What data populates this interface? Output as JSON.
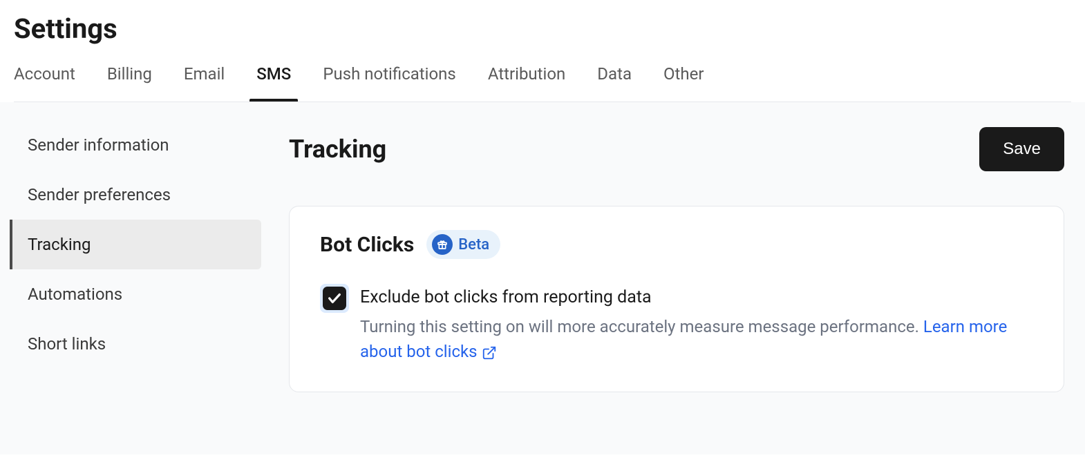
{
  "page_title": "Settings",
  "tabs": [
    {
      "label": "Account",
      "active": false
    },
    {
      "label": "Billing",
      "active": false
    },
    {
      "label": "Email",
      "active": false
    },
    {
      "label": "SMS",
      "active": true
    },
    {
      "label": "Push notifications",
      "active": false
    },
    {
      "label": "Attribution",
      "active": false
    },
    {
      "label": "Data",
      "active": false
    },
    {
      "label": "Other",
      "active": false
    }
  ],
  "sidebar": {
    "items": [
      {
        "label": "Sender information",
        "selected": false
      },
      {
        "label": "Sender preferences",
        "selected": false
      },
      {
        "label": "Tracking",
        "selected": true
      },
      {
        "label": "Automations",
        "selected": false
      },
      {
        "label": "Short links",
        "selected": false
      }
    ]
  },
  "content": {
    "section_title": "Tracking",
    "save_label": "Save",
    "card": {
      "title": "Bot Clicks",
      "badge_label": "Beta",
      "checkbox_checked": true,
      "checkbox_label": "Exclude bot clicks from reporting data",
      "checkbox_description": "Turning this setting on will more accurately measure message performance. ",
      "link_text": "Learn more about bot clicks"
    }
  }
}
